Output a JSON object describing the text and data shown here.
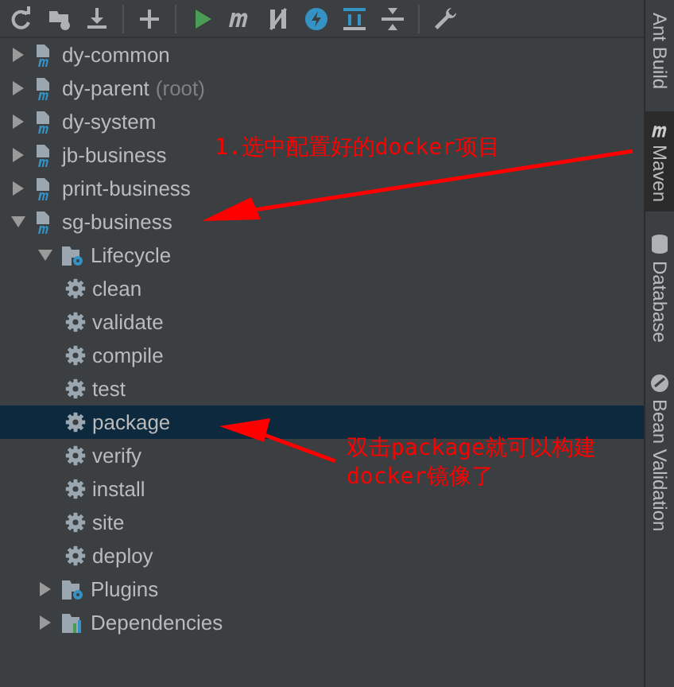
{
  "toolbar": {
    "buttons": [
      {
        "kind": "refresh"
      },
      {
        "kind": "folder-refresh"
      },
      {
        "kind": "download"
      },
      {
        "kind": "sep"
      },
      {
        "kind": "plus"
      },
      {
        "kind": "sep"
      },
      {
        "kind": "run"
      },
      {
        "kind": "maven"
      },
      {
        "kind": "skip"
      },
      {
        "kind": "bolt"
      },
      {
        "kind": "deps"
      },
      {
        "kind": "collapse"
      },
      {
        "kind": "sep"
      },
      {
        "kind": "wrench"
      }
    ]
  },
  "tree": [
    {
      "label": "dy-common",
      "kind": "module",
      "expanded": false,
      "selected": false
    },
    {
      "label": "dy-parent",
      "note": "(root)",
      "kind": "module",
      "expanded": false,
      "selected": false
    },
    {
      "label": "dy-system",
      "kind": "module",
      "expanded": false,
      "selected": false
    },
    {
      "label": "jb-business",
      "kind": "module",
      "expanded": false,
      "selected": false
    },
    {
      "label": "print-business",
      "kind": "module",
      "expanded": false,
      "selected": false
    },
    {
      "label": "sg-business",
      "kind": "module",
      "expanded": true,
      "selected": false,
      "children": [
        {
          "label": "Lifecycle",
          "kind": "lifecycle",
          "expanded": true,
          "selected": false,
          "children": [
            {
              "label": "clean",
              "kind": "goal",
              "selected": false
            },
            {
              "label": "validate",
              "kind": "goal",
              "selected": false
            },
            {
              "label": "compile",
              "kind": "goal",
              "selected": false
            },
            {
              "label": "test",
              "kind": "goal",
              "selected": false
            },
            {
              "label": "package",
              "kind": "goal",
              "selected": true
            },
            {
              "label": "verify",
              "kind": "goal",
              "selected": false
            },
            {
              "label": "install",
              "kind": "goal",
              "selected": false
            },
            {
              "label": "site",
              "kind": "goal",
              "selected": false
            },
            {
              "label": "deploy",
              "kind": "goal",
              "selected": false
            }
          ]
        },
        {
          "label": "Plugins",
          "kind": "plugins",
          "expanded": false,
          "selected": false
        },
        {
          "label": "Dependencies",
          "kind": "dependencies",
          "expanded": false,
          "selected": false
        }
      ]
    }
  ],
  "side_tabs": [
    {
      "label": "Ant Build",
      "kind": "ant",
      "selected": false
    },
    {
      "label": "Maven",
      "kind": "maven",
      "selected": true
    },
    {
      "label": "Database",
      "kind": "database",
      "selected": false
    },
    {
      "label": "Bean Validation",
      "kind": "bean",
      "selected": false
    }
  ],
  "annotations": [
    {
      "lines": [
        "1.选中配置好的docker项目"
      ]
    },
    {
      "lines": [
        "双击package就可以构建",
        "docker镜像了"
      ]
    }
  ]
}
